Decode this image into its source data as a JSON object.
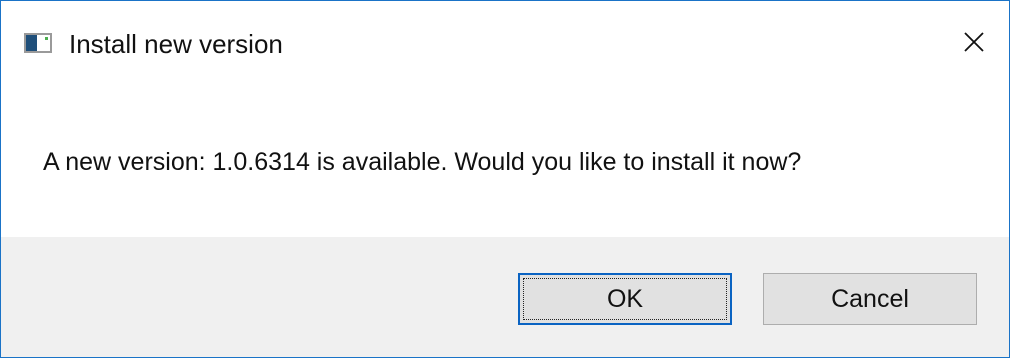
{
  "dialog": {
    "title": "Install new version",
    "message": "A new version: 1.0.6314 is available. Would you like to install it now?",
    "icons": {
      "app": "application-window-icon",
      "close": "close-icon"
    },
    "buttons": {
      "ok_label": "OK",
      "cancel_label": "Cancel"
    },
    "colors": {
      "border": "#1a73c7",
      "footer_background": "#f0f0f0",
      "button_background": "#e1e1e1",
      "default_button_border": "#0a63c2"
    }
  }
}
